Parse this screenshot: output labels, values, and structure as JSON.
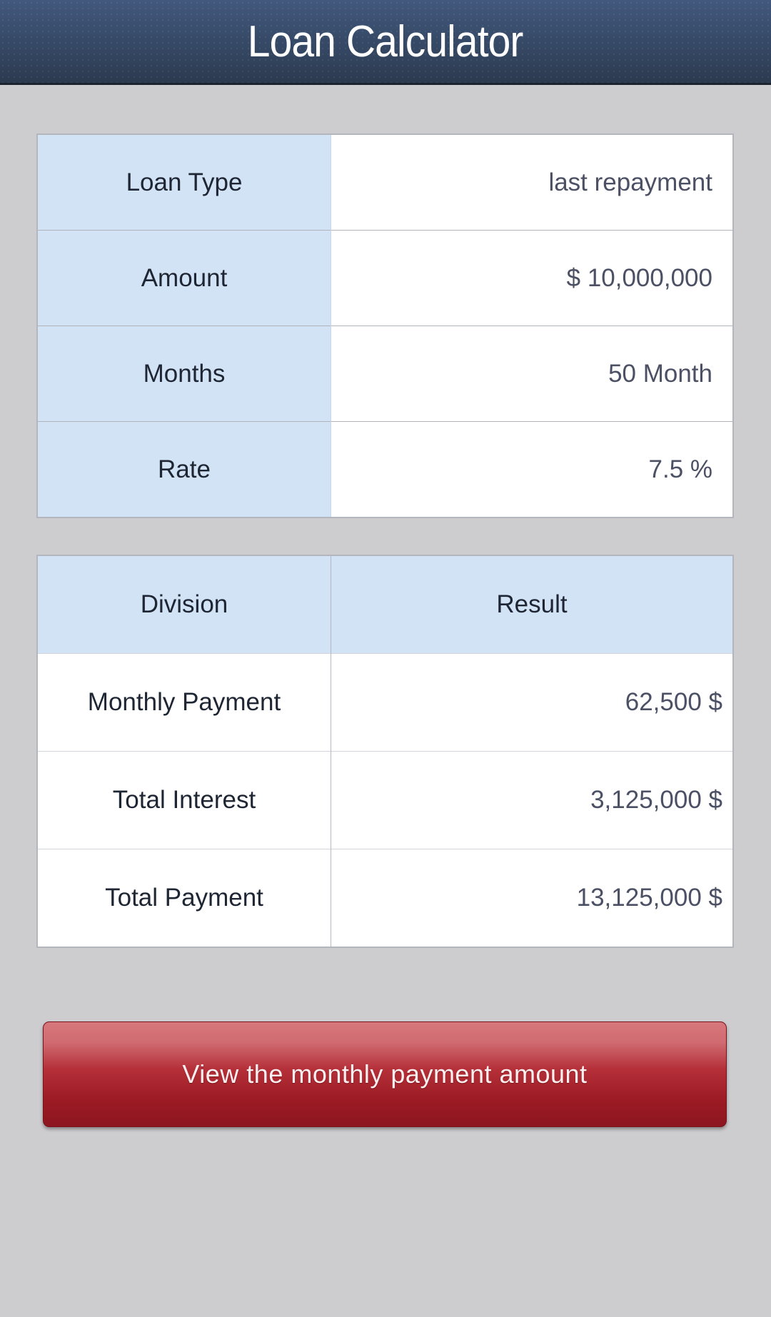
{
  "app": {
    "title": "Loan Calculator"
  },
  "inputs": [
    {
      "label": "Loan Type",
      "value": "last repayment"
    },
    {
      "label": "Amount",
      "value": "$ 10,000,000"
    },
    {
      "label": "Months",
      "value": "50 Month"
    },
    {
      "label": "Rate",
      "value": "7.5 %"
    }
  ],
  "results": {
    "headers": {
      "division": "Division",
      "result": "Result"
    },
    "rows": [
      {
        "label": "Monthly Payment",
        "value": "62,500 $"
      },
      {
        "label": "Total Interest",
        "value": "3,125,000 $"
      },
      {
        "label": "Total Payment",
        "value": "13,125,000 $"
      }
    ]
  },
  "actions": {
    "view_monthly_label": "View the monthly payment amount"
  },
  "colors": {
    "header_bg": "#374b69",
    "label_cell_bg": "#d3e3f6",
    "button_red": "#9c1a24"
  }
}
